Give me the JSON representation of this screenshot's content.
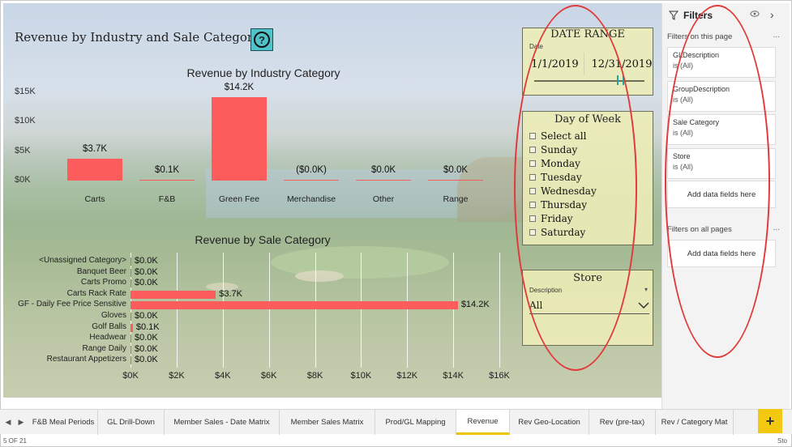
{
  "report": {
    "title": "Revenue by Industry and Sale Category...",
    "help_icon": "question-circle-icon",
    "help_symbol": "?"
  },
  "industry_chart": {
    "title": "Revenue by Industry Category",
    "y_ticks": [
      "$15K",
      "$10K",
      "$5K",
      "$0K"
    ],
    "data_labels": [
      "$3.7K",
      "$0.1K",
      "$14.2K",
      "($0.0K)",
      "$0.0K",
      "$0.0K"
    ],
    "bar_color": "#fd5c5c"
  },
  "sale_chart": {
    "title": "Revenue by Sale Category",
    "x_ticks": [
      "$0K",
      "$2K",
      "$4K",
      "$6K",
      "$8K",
      "$10K",
      "$12K",
      "$14K",
      "$16K"
    ],
    "data_labels": [
      "$0.0K",
      "$0.0K",
      "$0.0K",
      "$3.7K",
      "$14.2K",
      "$0.0K",
      "$0.1K",
      "$0.0K",
      "$0.0K",
      "$0.0K"
    ]
  },
  "chart_data": [
    {
      "type": "bar",
      "title": "Revenue by Industry Category",
      "categories": [
        "Carts",
        "F&B",
        "Green Fee",
        "Merchandise",
        "Other",
        "Range"
      ],
      "values": [
        3.7,
        0.1,
        14.2,
        -0.0,
        0.0,
        0.0
      ],
      "xlabel": "",
      "ylabel": "",
      "ylim": [
        0,
        15
      ],
      "unit": "$K"
    },
    {
      "type": "bar",
      "orientation": "horizontal",
      "title": "Revenue by Sale Category",
      "categories": [
        "<Unassigned Category>",
        "Banquet Beer",
        "Carts Promo",
        "Carts Rack Rate",
        "GF - Daily Fee Price Sensitive",
        "Gloves",
        "Golf Balls",
        "Headwear",
        "Range Daily",
        "Restaurant Appetizers"
      ],
      "values": [
        0.0,
        0.0,
        0.0,
        3.7,
        14.2,
        0.0,
        0.1,
        0.0,
        0.0,
        0.0
      ],
      "xlim": [
        0,
        16
      ],
      "unit": "$K"
    }
  ],
  "date_slicer": {
    "header": "DATE RANGE",
    "field_label": "Date",
    "start": "1/1/2019",
    "end": "12/31/2019"
  },
  "dow_slicer": {
    "header": "Day of Week",
    "items": [
      "Select all",
      "Sunday",
      "Monday",
      "Tuesday",
      "Wednesday",
      "Thursday",
      "Friday",
      "Saturday"
    ]
  },
  "store_slicer": {
    "header": "Store",
    "field_label": "Description",
    "value": "All",
    "dropdown_icon": "chevron-down-icon"
  },
  "filters": {
    "title": "Filters",
    "on_page_label": "Filters on this page",
    "all_pages_label": "Filters on all pages",
    "more": "...",
    "add_label": "Add data fields here",
    "cards": [
      {
        "name": "GLDescription",
        "value": "is (All)"
      },
      {
        "name": "GroupDescription",
        "value": "is (All)"
      },
      {
        "name": "Sale Category",
        "value": "is (All)"
      },
      {
        "name": "Store",
        "value": "is (All)"
      }
    ]
  },
  "tabs": {
    "prev": "◀",
    "next": "▶",
    "items": [
      "F&B Meal Periods",
      "GL Drill-Down",
      "Member Sales - Date Matrix",
      "Member Sales Matrix",
      "Prod/GL Mapping",
      "Revenue",
      "Rev Geo-Location",
      "Rev (pre-tax)",
      "Rev / Category Mat"
    ],
    "active": "Revenue",
    "add": "+"
  },
  "status": {
    "page": "5 OF 21",
    "right": "Sto"
  },
  "colors": {
    "bar": "#fd5c5c",
    "slicer_bg": "#ececb7",
    "annotation": "#e13a3a",
    "accent_tab": "#f2c811"
  }
}
